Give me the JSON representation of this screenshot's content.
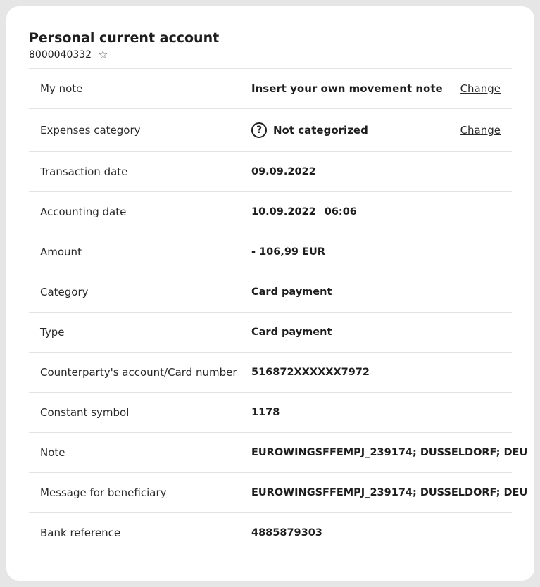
{
  "account": {
    "title": "Personal current account",
    "number": "8000040332",
    "favorite_icon": "star-outline-icon"
  },
  "details": {
    "my_note": {
      "label": "My note",
      "value": "Insert your own movement note",
      "action": "Change"
    },
    "expenses_category": {
      "label": "Expenses category",
      "icon": "question-circle-icon",
      "icon_glyph": "?",
      "value": "Not categorized",
      "action": "Change"
    },
    "transaction_date": {
      "label": "Transaction date",
      "value": "09.09.2022"
    },
    "accounting_date": {
      "label": "Accounting date",
      "date": "10.09.2022",
      "time": "06:06"
    },
    "amount": {
      "label": "Amount",
      "value": "- 106,99 EUR"
    },
    "category": {
      "label": "Category",
      "value": "Card payment"
    },
    "type": {
      "label": "Type",
      "value": "Card payment"
    },
    "counterparty": {
      "label": "Counterparty's account/Card number",
      "value": "516872XXXXXX7972"
    },
    "constant_symbol": {
      "label": "Constant symbol",
      "value": "1178"
    },
    "note": {
      "label": "Note",
      "value": "EUROWINGSFFEMPJ_239174; DUSSELDORF; DEU"
    },
    "message": {
      "label": "Message for beneficiary",
      "value": "EUROWINGSFFEMPJ_239174; DUSSELDORF; DEU"
    },
    "bank_reference": {
      "label": "Bank reference",
      "value": "4885879303"
    }
  }
}
